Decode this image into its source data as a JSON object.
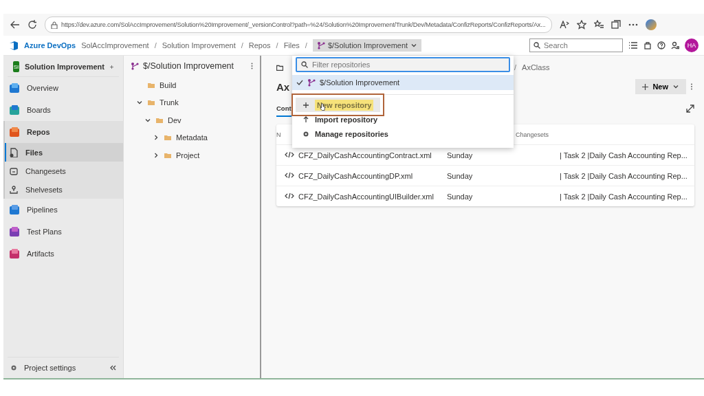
{
  "browser": {
    "url": "https://dev.azure.com/SolAccImprovement/Solution%20Improvement/_versionControl?path=%24/Solution%20Improvement/Trunk/Dev/Metadata/ConfizReports/ConfizReports/Ax..."
  },
  "header": {
    "product": "Azure DevOps",
    "breadcrumbs": [
      {
        "kind": "link",
        "text": "SolAccImprovement"
      },
      {
        "kind": "separator",
        "text": "/"
      },
      {
        "kind": "link",
        "text": "Solution Improvement"
      },
      {
        "kind": "separator",
        "text": "/"
      },
      {
        "kind": "link",
        "text": "Repos"
      },
      {
        "kind": "separator",
        "text": "/"
      },
      {
        "kind": "link",
        "text": "Files"
      },
      {
        "kind": "separator",
        "text": "/"
      }
    ],
    "repo_selector": "$/Solution Improvement",
    "search": {
      "placeholder": "Search"
    },
    "avatar": "HA"
  },
  "sidebar": {
    "project": {
      "initials": "SI",
      "name": "Solution Improvement"
    },
    "items": [
      {
        "label": "Overview",
        "selected": false
      },
      {
        "label": "Boards",
        "selected": false
      },
      {
        "label": "Repos",
        "selected": false,
        "expanded": true,
        "children": [
          {
            "label": "Files",
            "selected": true
          },
          {
            "label": "Changesets",
            "selected": false
          },
          {
            "label": "Shelvesets",
            "selected": false
          }
        ]
      },
      {
        "label": "Pipelines",
        "selected": false
      },
      {
        "label": "Test Plans",
        "selected": false
      },
      {
        "label": "Artifacts",
        "selected": false
      }
    ],
    "footer": "Project settings"
  },
  "tree": {
    "title": "$/Solution Improvement",
    "nodes": [
      {
        "label": "Build",
        "expandable": false
      },
      {
        "label": "Trunk",
        "expandable": true,
        "expanded": true,
        "children": [
          {
            "label": "Dev",
            "expandable": true,
            "expanded": true,
            "children": [
              {
                "label": "Metadata",
                "expandable": true,
                "expanded": false
              },
              {
                "label": "Project",
                "expandable": true,
                "expanded": false
              }
            ]
          }
        ]
      }
    ]
  },
  "main": {
    "breadcrumb": [
      {
        "kind": "separator",
        "text": "/"
      },
      {
        "kind": "link",
        "text": "AxClass"
      }
    ],
    "title": "Ax",
    "tab": {
      "label": "Cont",
      "selected": true
    },
    "new_button": "New",
    "columns": [
      "N",
      "Changesets"
    ],
    "rows": [
      {
        "name": "CFZ_DailyCashAccountingContract.xml",
        "date": "Sunday",
        "message": "| Task 2 |Daily Cash Accounting Rep..."
      },
      {
        "name": "CFZ_DailyCashAccountingDP.xml",
        "date": "Sunday",
        "message": "| Task 2 |Daily Cash Accounting Rep..."
      },
      {
        "name": "CFZ_DailyCashAccountingUIBuilder.xml",
        "date": "Sunday",
        "message": "| Task 2 |Daily Cash Accounting Rep..."
      }
    ]
  },
  "dropdown": {
    "filter": {
      "placeholder": "Filter repositories"
    },
    "repos": [
      {
        "label": "$/Solution Improvement",
        "selected": true
      }
    ],
    "actions": [
      {
        "label": "New repository",
        "highlighted": true
      },
      {
        "label": "Import repository",
        "highlighted": false
      },
      {
        "label": "Manage repositories",
        "highlighted": false
      }
    ]
  }
}
